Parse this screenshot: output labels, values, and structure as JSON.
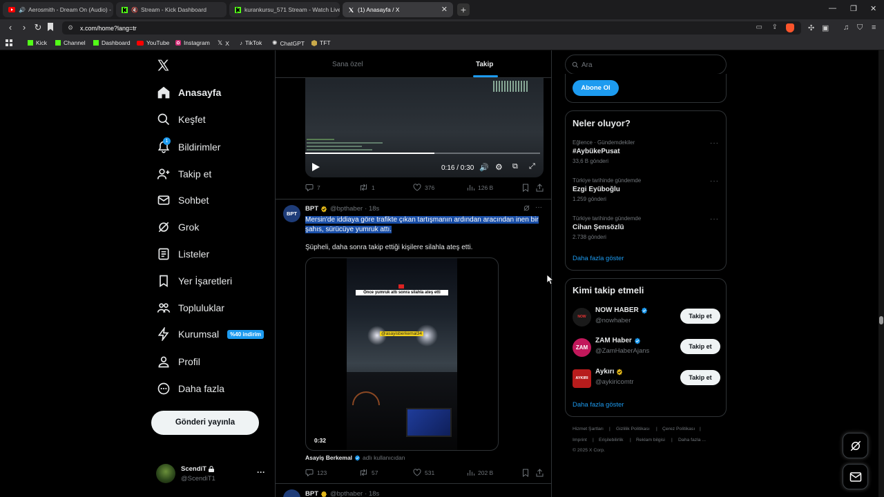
{
  "browser": {
    "tabs": [
      {
        "title": "Aerosmith - Dream On (Audio) -",
        "icon": "youtube-icon"
      },
      {
        "title": "Stream - Kick Dashboard",
        "icon": "kick-icon"
      },
      {
        "title": "kurankursu_571 Stream - Watch Live",
        "icon": "kick-icon"
      },
      {
        "title": "(1) Anasayfa / X",
        "icon": "x-logo-icon"
      }
    ],
    "url": "x.com/home?lang=tr",
    "bookmarks": [
      "Kick",
      "Channel",
      "Dashboard",
      "YouTube",
      "Instagram",
      "X",
      "TikTok",
      "ChatGPT",
      "TFT"
    ]
  },
  "sidebar": {
    "items": [
      {
        "label": "Anasayfa",
        "icon": "home-icon"
      },
      {
        "label": "Keşfet",
        "icon": "search-icon"
      },
      {
        "label": "Bildirimler",
        "icon": "bell-icon",
        "count": "1"
      },
      {
        "label": "Takip et",
        "icon": "person-add-icon"
      },
      {
        "label": "Sohbet",
        "icon": "mail-icon"
      },
      {
        "label": "Grok",
        "icon": "grok-icon"
      },
      {
        "label": "Listeler",
        "icon": "list-icon"
      },
      {
        "label": "Yer İşaretleri",
        "icon": "bookmark-icon"
      },
      {
        "label": "Topluluklar",
        "icon": "communities-icon"
      },
      {
        "label": "Kurumsal",
        "icon": "lightning-icon",
        "badge": "%40 indirim"
      },
      {
        "label": "Profil",
        "icon": "profile-icon"
      },
      {
        "label": "Daha fazla",
        "icon": "more-circle-icon"
      }
    ],
    "post_button": "Gönderi yayınla",
    "account": {
      "name": "ScendiT",
      "handle": "@ScendiT1",
      "more": "···"
    }
  },
  "timeline": {
    "tabs": [
      "Sana özel",
      "Takip"
    ],
    "video1": {
      "time": "0:16 / 0:30",
      "progress": 0.55
    },
    "tweet1_actions": {
      "replies": "7",
      "reposts": "1",
      "likes": "376",
      "views": "126 B"
    },
    "tweet2": {
      "name": "BPT",
      "handle": "@bpthaber",
      "time": "· 18s",
      "avatar": "BPT",
      "text_highlighted": "Mersin'de iddiaya göre trafikte çıkan tartışmanın ardından aracından inen bir şahıs, sürücüye yumruk attı.",
      "text_second": "Şüpheli, daha sonra takip ettiği kişilere silahla ateş etti.",
      "video_caption": "Önce yumruk attı sonra silahla ateş etti",
      "video_handle": "@asayisberkemal34",
      "duration": "0:32",
      "attribution_name": "Asayiş Berkemal",
      "attribution_suffix": "adlı kullanıcıdan",
      "actions": {
        "replies": "123",
        "reposts": "57",
        "likes": "531",
        "views": "202 B"
      }
    },
    "tweet3": {
      "name": "BPT",
      "handle": "@bpthaber",
      "time": "· 18s"
    }
  },
  "right": {
    "search_placeholder": "Ara",
    "subscribe_button": "Abone Ol",
    "trends_title": "Neler oluyor?",
    "trends": [
      {
        "meta": "Eğlence · Gündemdekiler",
        "name": "#AybükePusat",
        "count": "33,6 B gönderi"
      },
      {
        "meta": "Türkiye tarihinde gündemde",
        "name": "Ezgi Eyüboğlu",
        "count": "1.259 gönderi"
      },
      {
        "meta": "Türkiye tarihinde gündemde",
        "name": "Cihan Şensözlü",
        "count": "2.738 gönderi"
      }
    ],
    "trends_more": "Daha fazla göster",
    "who_title": "Kimi takip etmeli",
    "who": [
      {
        "name": "NOW HABER",
        "handle": "@nowhaber",
        "verified": "blue",
        "avatar_text": "NOW HABER",
        "avatar_color": "#1a1a1a"
      },
      {
        "name": "ZAM Haber",
        "handle": "@ZamHaberAjans",
        "verified": "blue",
        "avatar_text": "ZAM",
        "avatar_color": "#c2185b"
      },
      {
        "name": "Aykırı",
        "handle": "@aykiricomtr",
        "verified": "gold",
        "avatar_text": "AYKIRI",
        "avatar_color": "#b71c1c"
      }
    ],
    "follow_label": "Takip et",
    "who_more": "Daha fazla göster",
    "footer": [
      "Hizmet Şartları",
      "Gizlilik Politikası",
      "Çerez Politikası",
      "Imprint",
      "Erişilebilirlik",
      "Reklam bilgisi",
      "Daha fazla ...",
      "© 2025 X Corp."
    ]
  },
  "colors": {
    "accent": "#1d9bf0",
    "background": "#000000",
    "border": "#2f3336",
    "muted": "#71767b",
    "highlight": "#1a4fa8"
  }
}
